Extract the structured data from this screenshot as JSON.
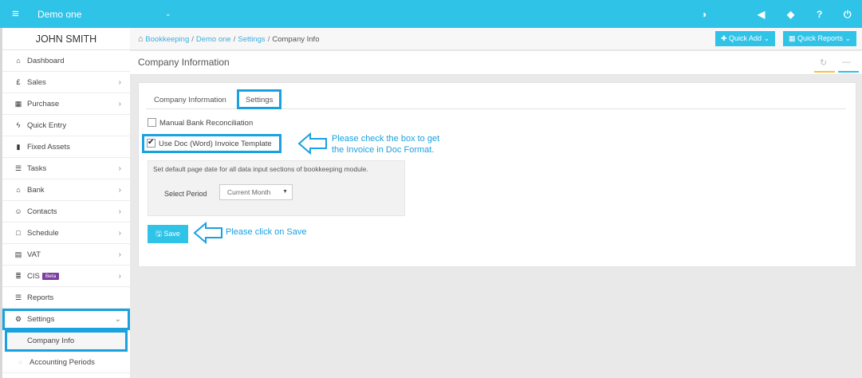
{
  "topbar": {
    "menu_icon": "≡",
    "company": "Demo one",
    "caret": "⌄",
    "icons": [
      "dashboard-icon",
      "megaphone-icon",
      "tag-icon",
      "help-icon",
      "power-icon"
    ],
    "icon_glyphs": [
      "◑",
      "◀",
      "◆",
      "?",
      "⏻"
    ]
  },
  "sidebar": {
    "user": "JOHN SMITH",
    "items": [
      {
        "label": "Dashboard",
        "icon": "⌂",
        "chev": ""
      },
      {
        "label": "Sales",
        "icon": "£",
        "chev": "›"
      },
      {
        "label": "Purchase",
        "icon": "▦",
        "chev": "›"
      },
      {
        "label": "Quick Entry",
        "icon": "ϟ",
        "chev": ""
      },
      {
        "label": "Fixed Assets",
        "icon": "▮",
        "chev": ""
      },
      {
        "label": "Tasks",
        "icon": "☰",
        "chev": "›"
      },
      {
        "label": "Bank",
        "icon": "⌂",
        "chev": "›"
      },
      {
        "label": "Contacts",
        "icon": "☺",
        "chev": "›"
      },
      {
        "label": "Schedule",
        "icon": "□",
        "chev": "›"
      },
      {
        "label": "VAT",
        "icon": "▤",
        "chev": "›"
      },
      {
        "label": "CIS",
        "icon": "≣",
        "chev": "›",
        "badge": "Beta"
      },
      {
        "label": "Reports",
        "icon": "☰",
        "chev": ""
      }
    ],
    "settings": {
      "label": "Settings",
      "icon": "⚙",
      "chev": "⌄"
    },
    "sub_items": [
      "Company Info",
      "Accounting Periods"
    ]
  },
  "breadcrumb": {
    "home_icon": "⌂",
    "items": [
      "Bookkeeping",
      "Demo one",
      "Settings"
    ],
    "current": "Company Info",
    "sep": "/"
  },
  "actions": {
    "quick_add": "✚ Quick Add ⌄",
    "quick_reports": "▦ Quick Reports ⌄"
  },
  "page": {
    "title": "Company Information",
    "refresh_icon": "↻",
    "collapse_icon": "—"
  },
  "tabs": [
    "Company Information",
    "Settings"
  ],
  "settings_form": {
    "bank_reconciliation": "Manual Bank Reconciliation",
    "doc_invoice": "Use Doc (Word) Invoice Template",
    "period_desc": "Set default page date for all data input sections of bookkeeping module.",
    "period_label": "Select Period",
    "period_value": "Current Month",
    "period_arrow": "▼",
    "save": "🖫 Save"
  },
  "annotations": {
    "check_note_1": "Please check the box to get",
    "check_note_2": "the Invoice in Doc Format.",
    "save_note": "Please click on Save"
  },
  "colors": {
    "accent": "#2fc3e8",
    "highlight": "#1aa1e0",
    "beta": "#7b3fa0"
  }
}
